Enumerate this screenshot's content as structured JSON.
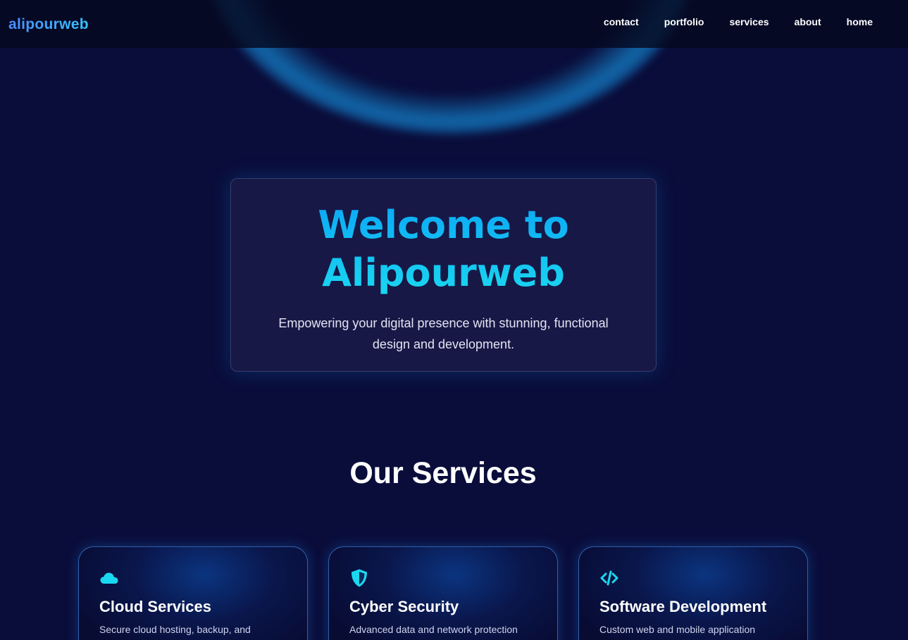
{
  "nav": {
    "logo": "alipourweb",
    "links": [
      "contact",
      "portfolio",
      "services",
      "about",
      "home"
    ]
  },
  "hero": {
    "title_line1": "Welcome to",
    "title_line2": "Alipourweb",
    "subtitle": "Empowering your digital presence with stunning, functional design and development."
  },
  "services": {
    "heading": "Our Services",
    "items": [
      {
        "icon": "cloud-icon",
        "title": "Cloud Services",
        "desc": "Secure cloud hosting, backup, and"
      },
      {
        "icon": "shield-icon",
        "title": "Cyber Security",
        "desc": "Advanced data and network protection"
      },
      {
        "icon": "code-icon",
        "title": "Software Development",
        "desc": "Custom web and mobile application"
      }
    ]
  },
  "colors": {
    "background": "#0a0d3a",
    "accent": "#0ba8f5",
    "icon": "#1ad8f0"
  }
}
